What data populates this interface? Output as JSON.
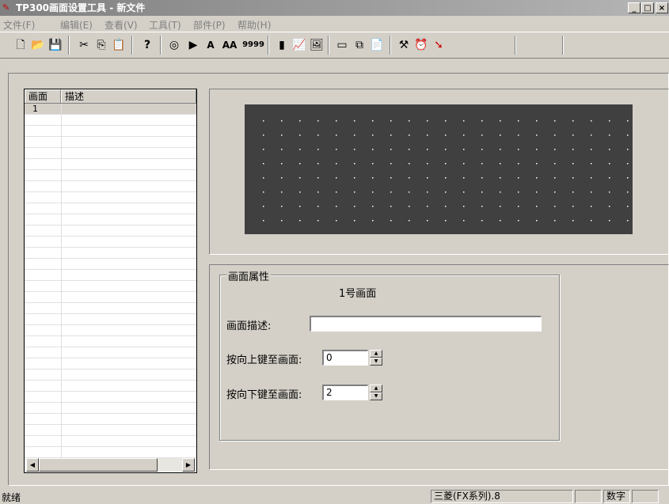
{
  "window": {
    "title": "TP300画面设置工具 - 新文件",
    "controls": {
      "minimize": "_",
      "maximize": "□",
      "close": "×"
    }
  },
  "menu": [
    {
      "label": "文件(F)"
    },
    {
      "label": "编辑(E)"
    },
    {
      "label": "查看(V)"
    },
    {
      "label": "工具(T)"
    },
    {
      "label": "部件(P)"
    },
    {
      "label": "帮助(H)"
    }
  ],
  "toolbar": {
    "icons": [
      "new-file-icon",
      "open-folder-icon",
      "save-icon",
      "cut-icon",
      "copy-icon",
      "paste-icon",
      "help-icon",
      "target-icon",
      "run-icon",
      "text-a-icon",
      "text-aa-icon",
      "number-display-icon",
      "bar-icon",
      "trend-chart-icon",
      "image-icon",
      "frame-icon",
      "window-icon",
      "document-icon",
      "tools-icon",
      "alarm-clock-icon",
      "arrow-icon"
    ],
    "text_a": "A",
    "text_aa": "AA",
    "numbers": "9999"
  },
  "screen_list": {
    "headers": [
      "画面",
      "描述"
    ],
    "rows": [
      {
        "number": "1",
        "description": ""
      }
    ]
  },
  "properties": {
    "group_title": "画面属性",
    "screen_name": "1号画面",
    "description_label": "画面描述:",
    "description_value": "",
    "up_key_label": "按向上键至画面:",
    "up_key_value": "0",
    "down_key_label": "按向下键至画面:",
    "down_key_value": "2"
  },
  "status": {
    "ready": "就绪",
    "plc": "三菱(FX系列).8",
    "numlock": "数字"
  },
  "colors": {
    "window_bg": "#d4d0c8",
    "screen_bg": "#404040",
    "screen_dot": "#ffffff",
    "title_gradient_start": "#808080"
  }
}
